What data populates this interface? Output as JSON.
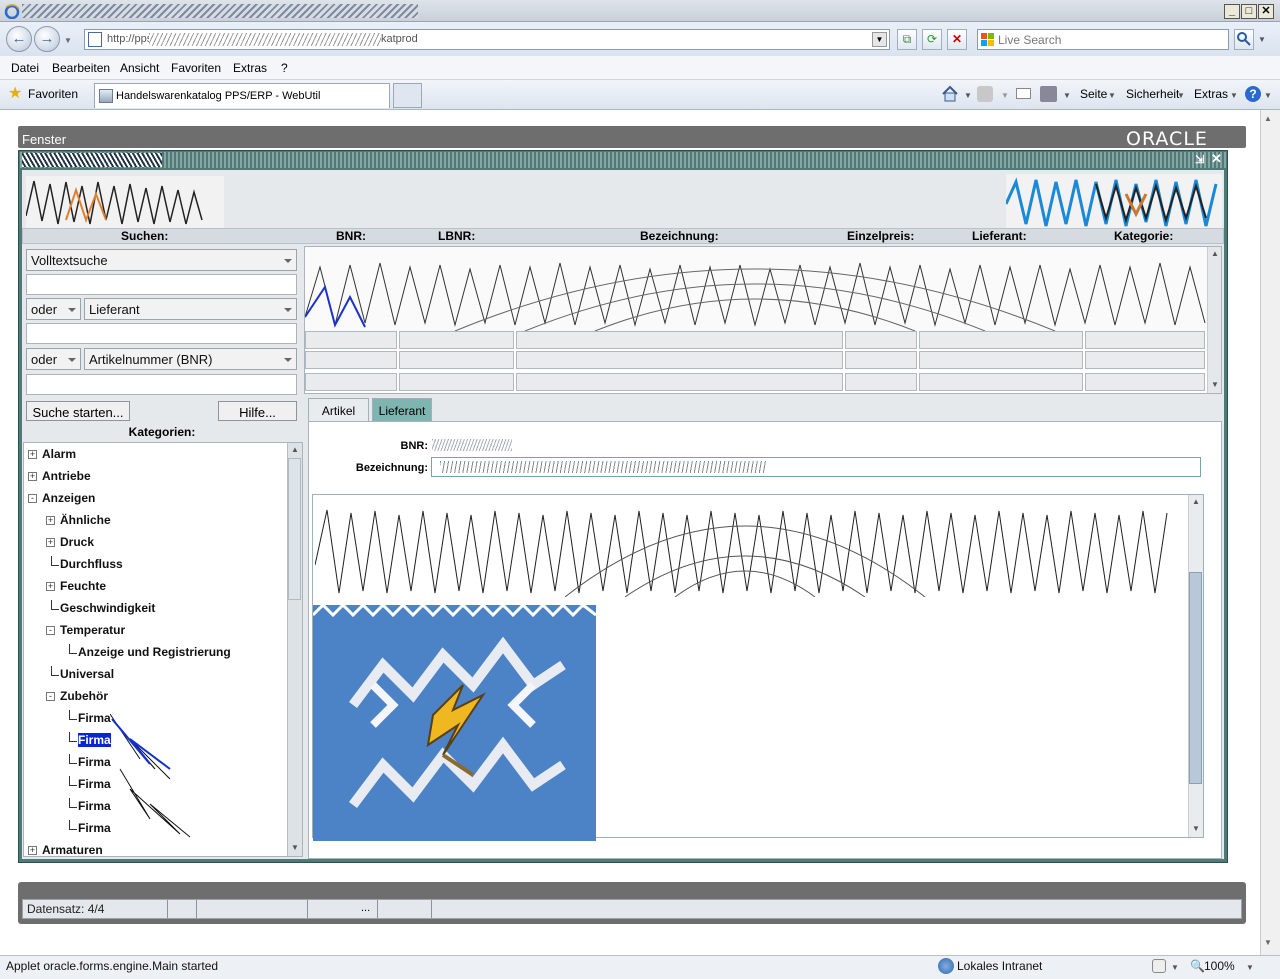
{
  "browser": {
    "url_prefix": "http://pps",
    "url_suffix": "katprod",
    "search_placeholder": "Live Search",
    "menu": [
      "Datei",
      "Bearbeiten",
      "Ansicht",
      "Favoriten",
      "Extras",
      "?"
    ],
    "favorites_label": "Favoriten",
    "tab_title": "Handelswarenkatalog PPS/ERP - WebUtil",
    "commands": {
      "seite": "Seite",
      "sicherheit": "Sicherheit",
      "extras": "Extras"
    },
    "status_text": "Applet oracle.forms.engine.Main started",
    "zone": "Lokales Intranet",
    "zoom": "100%"
  },
  "app": {
    "fenster": "Fenster",
    "vendor_logo": "ORACLE",
    "columns": {
      "suchen": "Suchen:",
      "bnr": "BNR:",
      "lbnr": "LBNR:",
      "bezeichnung": "Bezeichnung:",
      "einzelpreis": "Einzelpreis:",
      "lieferant": "Lieferant:",
      "kategorie": "Kategorie:"
    },
    "search": {
      "field1": "Volltextsuche",
      "op2": "oder",
      "field2": "Lieferant",
      "op3": "oder",
      "field3": "Artikelnummer (BNR)",
      "start_button": "Suche starten...",
      "help_button": "Hilfe..."
    },
    "categories_label": "Kategorien:",
    "tree": [
      {
        "label": "Alarm",
        "level": 0,
        "toggle": "+"
      },
      {
        "label": "Antriebe",
        "level": 0,
        "toggle": "+"
      },
      {
        "label": "Anzeigen",
        "level": 0,
        "toggle": "-"
      },
      {
        "label": "Ähnliche",
        "level": 1,
        "toggle": "+"
      },
      {
        "label": "Druck",
        "level": 1,
        "toggle": "+"
      },
      {
        "label": "Durchfluss",
        "level": 1,
        "toggle": ""
      },
      {
        "label": "Feuchte",
        "level": 1,
        "toggle": "+"
      },
      {
        "label": "Geschwindigkeit",
        "level": 1,
        "toggle": ""
      },
      {
        "label": "Temperatur",
        "level": 1,
        "toggle": "-"
      },
      {
        "label": "Anzeige und Registrierung",
        "level": 2,
        "toggle": ""
      },
      {
        "label": "Universal",
        "level": 1,
        "toggle": ""
      },
      {
        "label": "Zubehör",
        "level": 1,
        "toggle": "-"
      },
      {
        "label": "Firma",
        "level": 2,
        "toggle": ""
      },
      {
        "label": "Firma",
        "level": 2,
        "toggle": "",
        "selected": true
      },
      {
        "label": "Firma",
        "level": 2,
        "toggle": ""
      },
      {
        "label": "Firma",
        "level": 2,
        "toggle": ""
      },
      {
        "label": "Firma",
        "level": 2,
        "toggle": ""
      },
      {
        "label": "Firma",
        "level": 2,
        "toggle": ""
      },
      {
        "label": "Armaturen",
        "level": 0,
        "toggle": "+"
      }
    ],
    "tabs": {
      "artikel": "Artikel",
      "lieferant": "Lieferant"
    },
    "detail": {
      "bnr_label": "BNR:",
      "bez_label": "Bezeichnung:"
    },
    "status": {
      "datensatz": "Datensatz: 4/4",
      "ellipsis": "..."
    }
  },
  "colors": {
    "accent": "#4e7a78",
    "selection": "#0a24d6",
    "tab_active": "#7fb5b0"
  }
}
